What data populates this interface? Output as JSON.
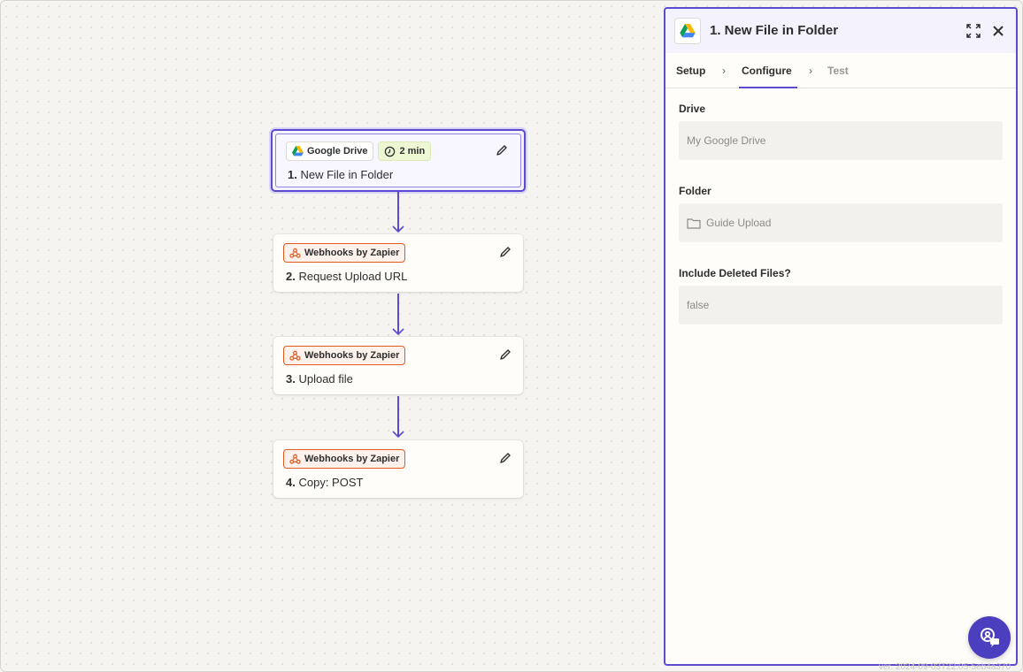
{
  "workflow": {
    "steps": [
      {
        "app": "Google Drive",
        "number": "1.",
        "title": "New File in Folder",
        "time_badge": "2 min",
        "app_icon": "google-drive-icon"
      },
      {
        "app": "Webhooks by Zapier",
        "number": "2.",
        "title": "Request Upload URL",
        "app_icon": "webhook-icon"
      },
      {
        "app": "Webhooks by Zapier",
        "number": "3.",
        "title": "Upload file",
        "app_icon": "webhook-icon"
      },
      {
        "app": "Webhooks by Zapier",
        "number": "4.",
        "title": "Copy: POST",
        "app_icon": "webhook-icon"
      }
    ]
  },
  "panel": {
    "title": "1. New File in Folder",
    "tabs": [
      {
        "label": "Setup",
        "state": "done"
      },
      {
        "label": "Configure",
        "state": "active"
      },
      {
        "label": "Test",
        "state": "disabled"
      }
    ],
    "fields": [
      {
        "label": "Drive",
        "value": "My Google Drive"
      },
      {
        "label": "Folder",
        "value": "Guide Upload",
        "icon": "folder-icon"
      },
      {
        "label": "Include Deleted Files?",
        "value": "false"
      }
    ]
  },
  "footer": {
    "version": "ver. 2024-09-03T22:05-5eb4a370"
  },
  "colors": {
    "accent": "#5b4bd1",
    "webhook": "#e35a1f",
    "time_badge": "#eef7d3"
  }
}
